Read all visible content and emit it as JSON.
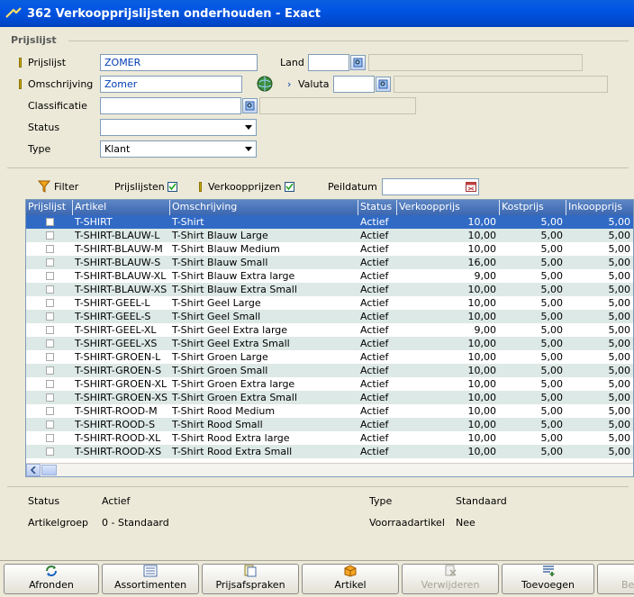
{
  "window": {
    "title": "362 Verkoopprijslijsten onderhouden - Exact"
  },
  "header_group": "Prijslijst",
  "form": {
    "prijslijst_label": "Prijslijst",
    "prijslijst_value": "ZOMER",
    "land_label": "Land",
    "omschrijving_label": "Omschrijving",
    "omschrijving_value": "Zomer",
    "valuta_label": "Valuta",
    "classificatie_label": "Classificatie",
    "status_label": "Status",
    "type_label": "Type",
    "type_value": "Klant"
  },
  "toolbar": {
    "filter_label": "Filter",
    "prijslijsten_label": "Prijslijsten",
    "prijslijsten_checked": true,
    "verkoopprijzen_label": "Verkoopprijzen",
    "verkoopprijzen_checked": true,
    "peildatum_label": "Peildatum"
  },
  "grid": {
    "columns": [
      "Prijslijst",
      "Artikel",
      "Omschrijving",
      "Status",
      "Verkoopprijs",
      "Kostprijs",
      "Inkoopprijs"
    ],
    "rows": [
      [
        "T-SHIRT",
        "T-Shirt",
        "Actief",
        "10,00",
        "5,00",
        "5,00"
      ],
      [
        "T-SHIRT-BLAUW-L",
        "T-Shirt Blauw Large",
        "Actief",
        "10,00",
        "5,00",
        "5,00"
      ],
      [
        "T-SHIRT-BLAUW-M",
        "T-Shirt Blauw Medium",
        "Actief",
        "10,00",
        "5,00",
        "5,00"
      ],
      [
        "T-SHIRT-BLAUW-S",
        "T-Shirt Blauw Small",
        "Actief",
        "16,00",
        "5,00",
        "5,00"
      ],
      [
        "T-SHIRT-BLAUW-XL",
        "T-Shirt Blauw Extra large",
        "Actief",
        "9,00",
        "5,00",
        "5,00"
      ],
      [
        "T-SHIRT-BLAUW-XS",
        "T-Shirt Blauw Extra Small",
        "Actief",
        "10,00",
        "5,00",
        "5,00"
      ],
      [
        "T-SHIRT-GEEL-L",
        "T-Shirt Geel Large",
        "Actief",
        "10,00",
        "5,00",
        "5,00"
      ],
      [
        "T-SHIRT-GEEL-S",
        "T-Shirt Geel Small",
        "Actief",
        "10,00",
        "5,00",
        "5,00"
      ],
      [
        "T-SHIRT-GEEL-XL",
        "T-Shirt Geel Extra large",
        "Actief",
        "9,00",
        "5,00",
        "5,00"
      ],
      [
        "T-SHIRT-GEEL-XS",
        "T-Shirt Geel Extra Small",
        "Actief",
        "10,00",
        "5,00",
        "5,00"
      ],
      [
        "T-SHIRT-GROEN-L",
        "T-Shirt Groen Large",
        "Actief",
        "10,00",
        "5,00",
        "5,00"
      ],
      [
        "T-SHIRT-GROEN-S",
        "T-Shirt Groen Small",
        "Actief",
        "10,00",
        "5,00",
        "5,00"
      ],
      [
        "T-SHIRT-GROEN-XL",
        "T-Shirt Groen Extra large",
        "Actief",
        "10,00",
        "5,00",
        "5,00"
      ],
      [
        "T-SHIRT-GROEN-XS",
        "T-Shirt Groen Extra Small",
        "Actief",
        "10,00",
        "5,00",
        "5,00"
      ],
      [
        "T-SHIRT-ROOD-M",
        "T-Shirt Rood Medium",
        "Actief",
        "10,00",
        "5,00",
        "5,00"
      ],
      [
        "T-SHIRT-ROOD-S",
        "T-Shirt Rood Small",
        "Actief",
        "10,00",
        "5,00",
        "5,00"
      ],
      [
        "T-SHIRT-ROOD-XL",
        "T-Shirt Rood Extra large",
        "Actief",
        "10,00",
        "5,00",
        "5,00"
      ],
      [
        "T-SHIRT-ROOD-XS",
        "T-Shirt Rood Extra Small",
        "Actief",
        "10,00",
        "5,00",
        "5,00"
      ]
    ]
  },
  "details": {
    "status_label": "Status",
    "status_value": "Actief",
    "type_label": "Type",
    "type_value": "Standaard",
    "artikelgroep_label": "Artikelgroep",
    "artikelgroep_value": "0 - Standaard",
    "voorraadartikel_label": "Voorraadartikel",
    "voorraadartikel_value": "Nee"
  },
  "buttons": {
    "afronden": "Afronden",
    "assortimenten": "Assortimenten",
    "prijsafspraken": "Prijsafspraken",
    "artikel": "Artikel",
    "verwijderen": "Verwijderen",
    "toevoegen": "Toevoegen",
    "partial": "Be"
  },
  "colors": {
    "titlebar": "#0054e3",
    "grid_header": "#3c67b0",
    "selected_row": "#316ac5",
    "alt_row": "#dde9e6",
    "window_bg": "#ece9d8"
  },
  "icons": [
    "app-icon",
    "browse-icon",
    "globe-icon",
    "filter-icon",
    "calendar-icon"
  ]
}
